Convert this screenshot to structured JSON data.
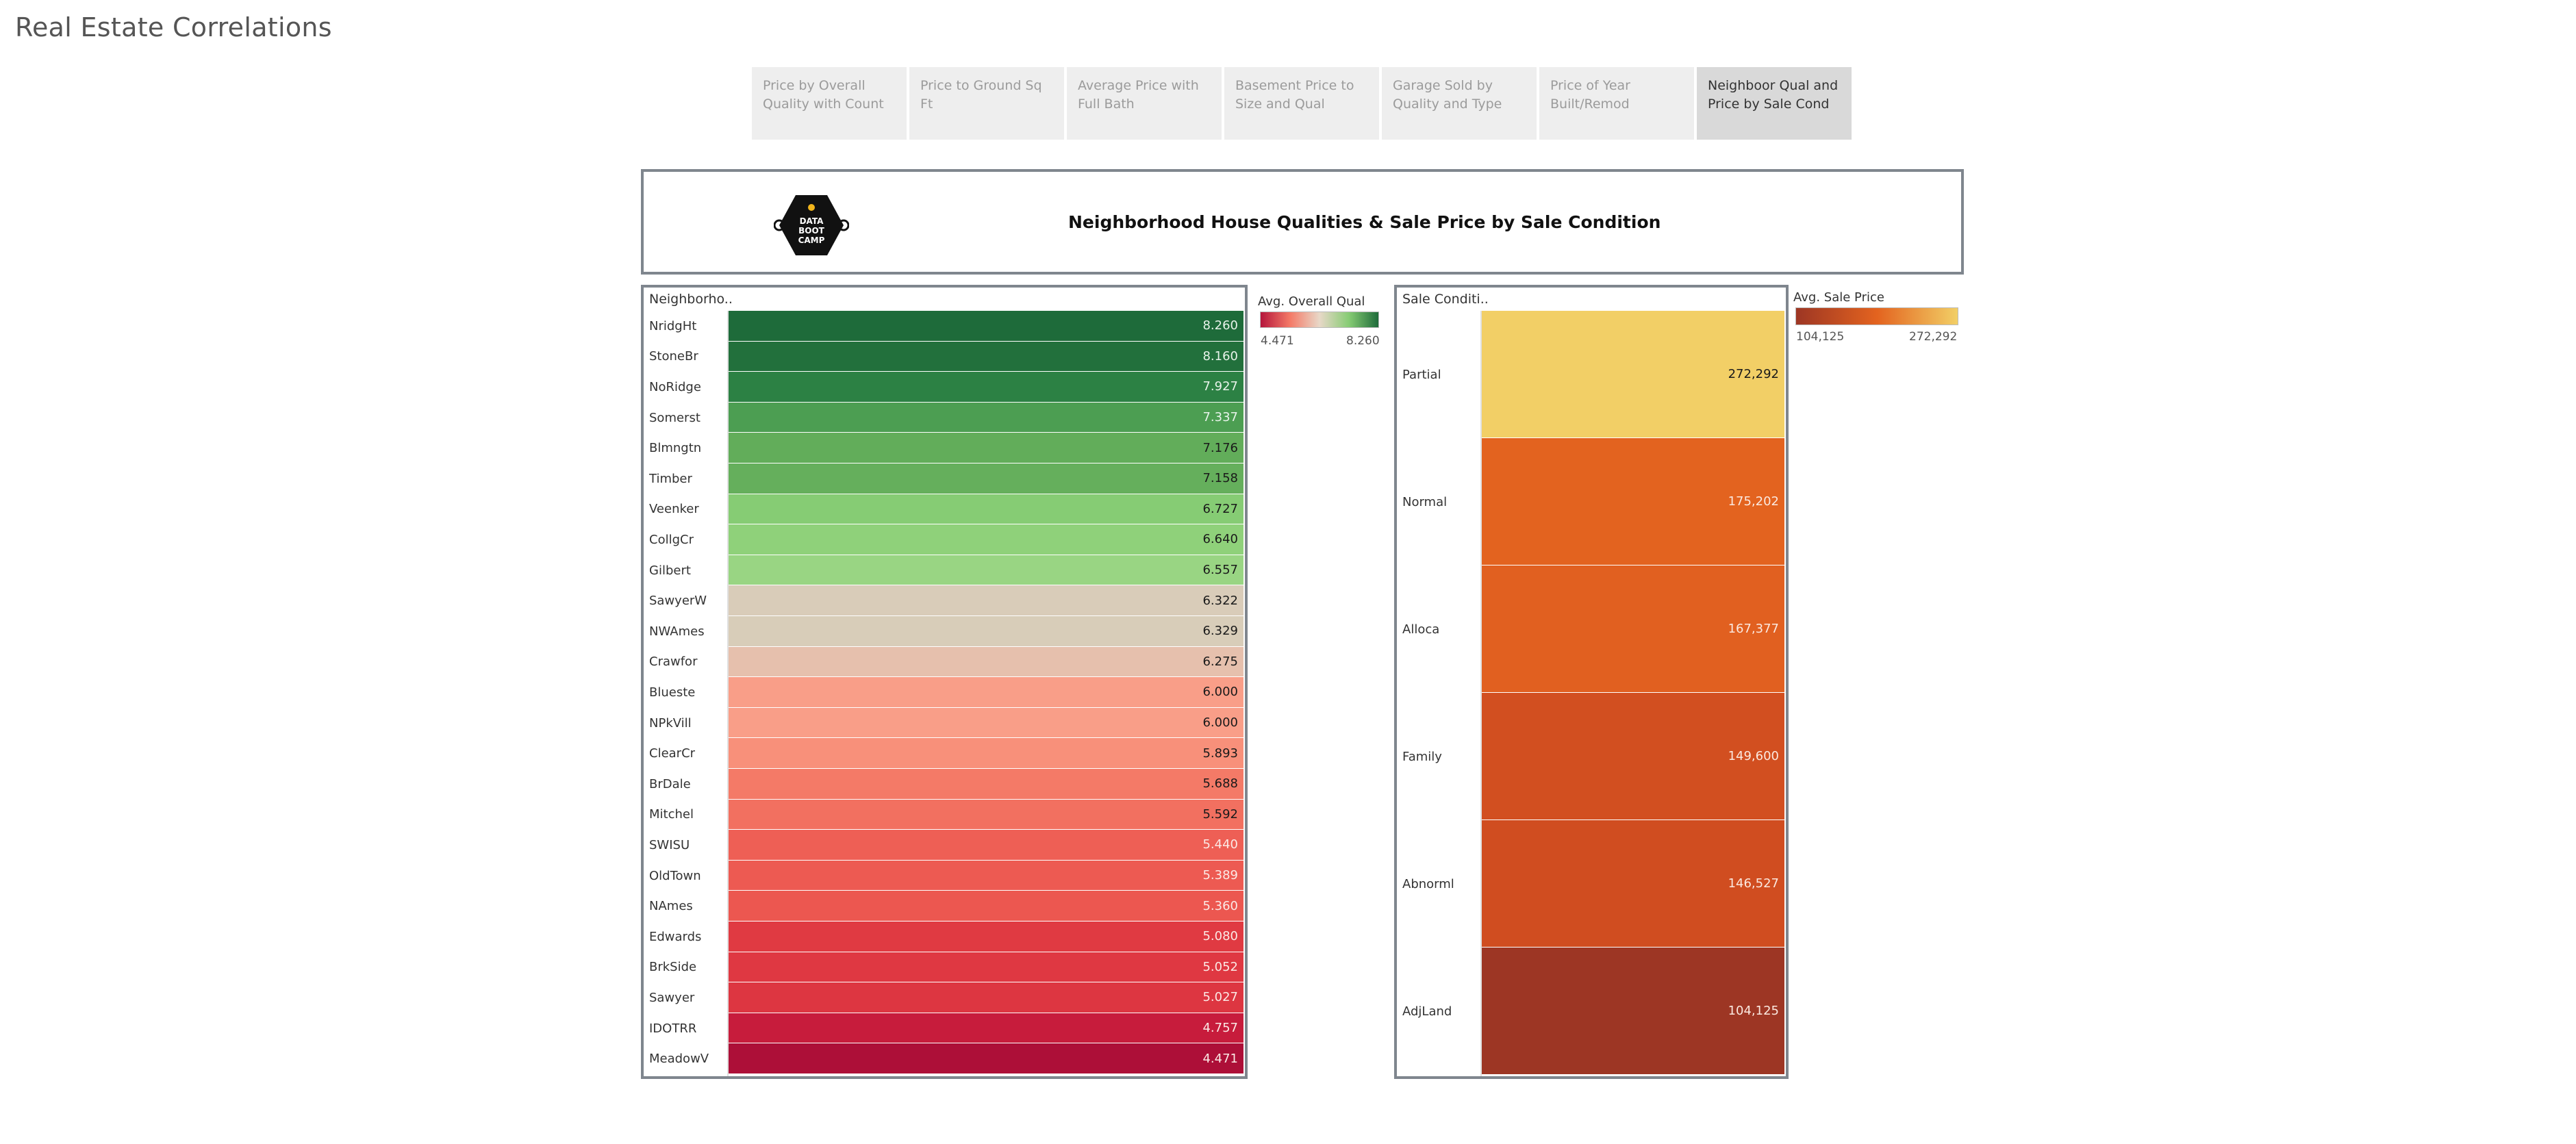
{
  "page": {
    "title": "Real Estate Correlations"
  },
  "tabs": [
    {
      "label": "Price by Overall Quality with Count",
      "active": false
    },
    {
      "label": "Price to Ground Sq Ft",
      "active": false
    },
    {
      "label": "Average Price with Full Bath",
      "active": false
    },
    {
      "label": "Basement Price to Size and Qual",
      "active": false
    },
    {
      "label": "Garage Sold by Quality and Type",
      "active": false
    },
    {
      "label": "Price of Year Built/Remod",
      "active": false
    },
    {
      "label": "Neighboor Qual and Price by Sale Cond",
      "active": true
    }
  ],
  "header": {
    "title": "Neighborhood House Qualities & Sale Price by Sale Condition",
    "logo_text": [
      "DATA",
      "BOOT",
      "CAMP"
    ]
  },
  "neighborhood": {
    "column_header": "Neighborho..",
    "legend": {
      "title": "Avg. Overall Qual",
      "min": "4.471",
      "max": "8.260"
    },
    "rows": [
      {
        "label": "NridgHt",
        "value": "8.260",
        "color": "#1e6b3a",
        "text_color": "#e8f3ea"
      },
      {
        "label": "StoneBr",
        "value": "8.160",
        "color": "#22703c",
        "text_color": "#e8f3ea"
      },
      {
        "label": "NoRidge",
        "value": "7.927",
        "color": "#2c8144",
        "text_color": "#e8f3ea"
      },
      {
        "label": "Somerst",
        "value": "7.337",
        "color": "#4c9e52",
        "text_color": "#e8f3ea"
      },
      {
        "label": "Blmngtn",
        "value": "7.176",
        "color": "#62ad5a",
        "text_color": "#1a1a1a"
      },
      {
        "label": "Timber",
        "value": "7.158",
        "color": "#65af5c",
        "text_color": "#1a1a1a"
      },
      {
        "label": "Veenker",
        "value": "6.727",
        "color": "#86cc74",
        "text_color": "#1a1a1a"
      },
      {
        "label": "CollgCr",
        "value": "6.640",
        "color": "#8fd17a",
        "text_color": "#1a1a1a"
      },
      {
        "label": "Gilbert",
        "value": "6.557",
        "color": "#99d583",
        "text_color": "#1a1a1a"
      },
      {
        "label": "SawyerW",
        "value": "6.322",
        "color": "#d9ccb9",
        "text_color": "#1a1a1a"
      },
      {
        "label": "NWAmes",
        "value": "6.329",
        "color": "#d8cdb9",
        "text_color": "#1a1a1a"
      },
      {
        "label": "Crawfor",
        "value": "6.275",
        "color": "#e6c0ad",
        "text_color": "#1a1a1a"
      },
      {
        "label": "Blueste",
        "value": "6.000",
        "color": "#f99e88",
        "text_color": "#1a1a1a"
      },
      {
        "label": "NPkVill",
        "value": "6.000",
        "color": "#f99e88",
        "text_color": "#1a1a1a"
      },
      {
        "label": "ClearCr",
        "value": "5.893",
        "color": "#f8907a",
        "text_color": "#1a1a1a"
      },
      {
        "label": "BrDale",
        "value": "5.688",
        "color": "#f47a67",
        "text_color": "#1a1a1a"
      },
      {
        "label": "Mitchel",
        "value": "5.592",
        "color": "#f27060",
        "text_color": "#1a1a1a"
      },
      {
        "label": "SWISU",
        "value": "5.440",
        "color": "#ee5f55",
        "text_color": "#fbe9e5"
      },
      {
        "label": "OldTown",
        "value": "5.389",
        "color": "#ed5a52",
        "text_color": "#fbe9e5"
      },
      {
        "label": "NAmes",
        "value": "5.360",
        "color": "#ec5750",
        "text_color": "#fbe9e5"
      },
      {
        "label": "Edwards",
        "value": "5.080",
        "color": "#e03a42",
        "text_color": "#fbe9e5"
      },
      {
        "label": "BrkSide",
        "value": "5.052",
        "color": "#df3842",
        "text_color": "#fbe9e5"
      },
      {
        "label": "Sawyer",
        "value": "5.027",
        "color": "#dd3641",
        "text_color": "#fbe9e5"
      },
      {
        "label": "IDOTRR",
        "value": "4.757",
        "color": "#c71c3c",
        "text_color": "#fbe9e5"
      },
      {
        "label": "MeadowV",
        "value": "4.471",
        "color": "#ad0f38",
        "text_color": "#fbe9e5"
      }
    ]
  },
  "sale_condition": {
    "column_header": "Sale Conditi..",
    "legend": {
      "title": "Avg. Sale Price",
      "min": "104,125",
      "max": "272,292"
    },
    "rows": [
      {
        "label": "Partial",
        "value": "272,292",
        "color": "#f2cf66",
        "text_color": "#1a1a1a"
      },
      {
        "label": "Normal",
        "value": "175,202",
        "color": "#e3631f",
        "text_color": "#fbe9e0"
      },
      {
        "label": "Alloca",
        "value": "167,377",
        "color": "#e16020",
        "text_color": "#fbe9e0"
      },
      {
        "label": "Family",
        "value": "149,600",
        "color": "#d24f20",
        "text_color": "#fbe9e0"
      },
      {
        "label": "Abnorml",
        "value": "146,527",
        "color": "#d04d20",
        "text_color": "#fbe9e0"
      },
      {
        "label": "AdjLand",
        "value": "104,125",
        "color": "#9d3624",
        "text_color": "#fbe9e0"
      }
    ]
  },
  "colors": {
    "qual_gradient": [
      "#b5163c",
      "#f47a67",
      "#e8d8c8",
      "#86cc74",
      "#1e6b3a"
    ],
    "price_gradient": [
      "#9d3624",
      "#e3631f",
      "#f2cf66"
    ]
  }
}
